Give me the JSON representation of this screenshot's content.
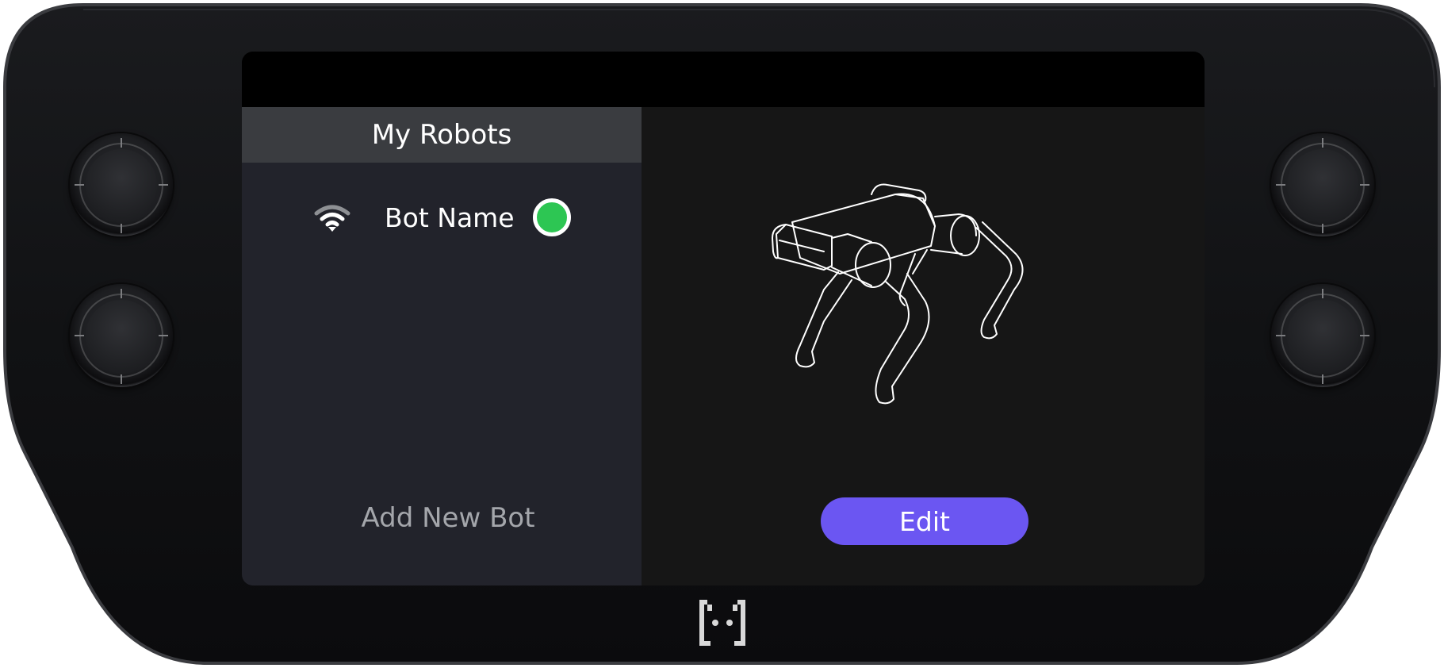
{
  "device": {
    "body_color": "#101113",
    "screen_topbar_color": "#000000"
  },
  "sidebar": {
    "header": "My Robots",
    "robots": [
      {
        "name": "Bot Name",
        "connection_icon": "wifi-icon",
        "status": "online",
        "status_color": "#2dc653"
      }
    ],
    "add_label": "Add New Bot"
  },
  "detail": {
    "illustration": "robot-dog-outline",
    "edit_label": "Edit",
    "accent_color": "#6b56f2"
  },
  "branding": {
    "logo_icon": "bracket-face-logo"
  }
}
